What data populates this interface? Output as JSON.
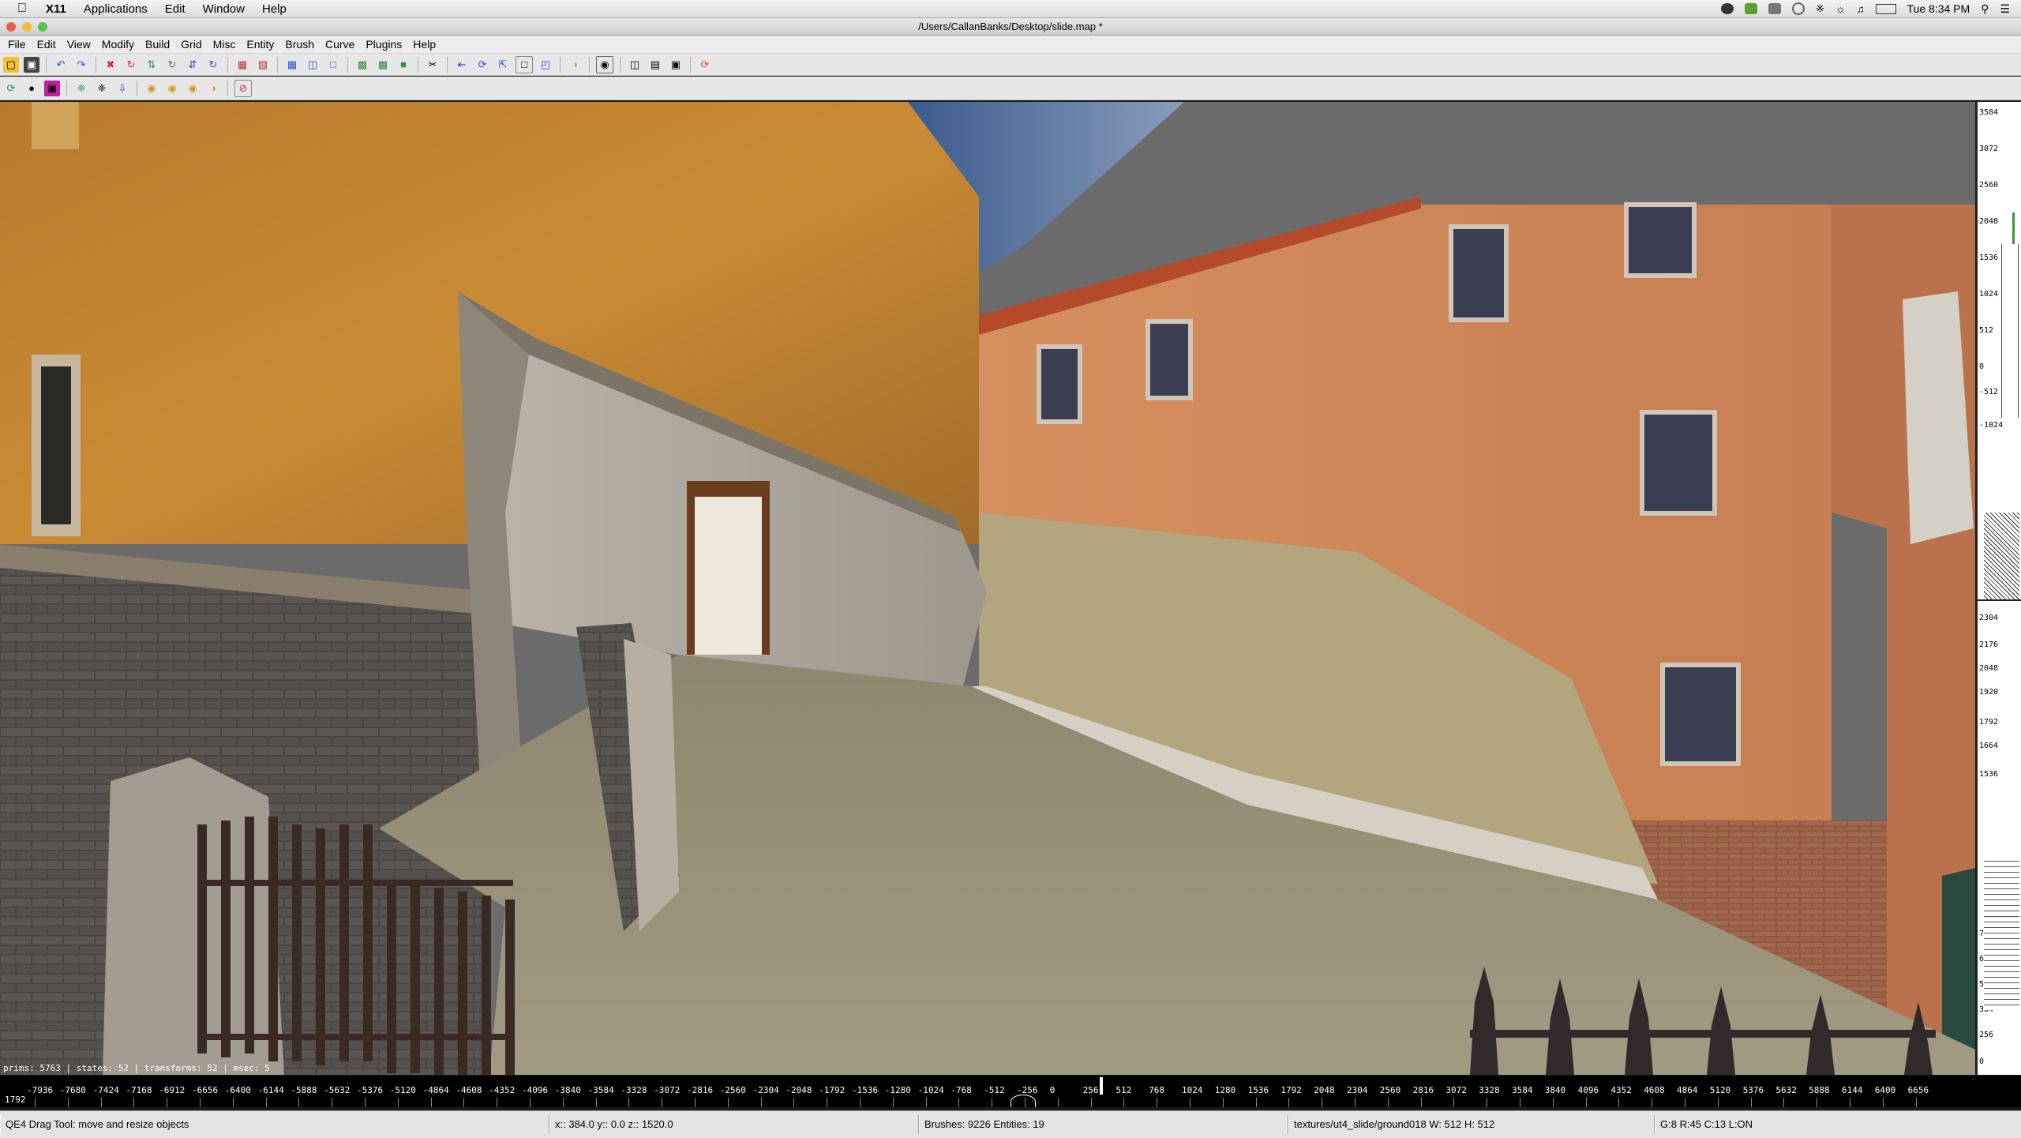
{
  "mac_menu": {
    "app": "X11",
    "items": [
      "Applications",
      "Edit",
      "Window",
      "Help"
    ],
    "clock": "Tue 8:34 PM"
  },
  "window": {
    "title": "/Users/CallanBanks/Desktop/slide.map *"
  },
  "app_menu": [
    "File",
    "Edit",
    "View",
    "Modify",
    "Build",
    "Grid",
    "Misc",
    "Entity",
    "Brush",
    "Curve",
    "Plugins",
    "Help"
  ],
  "viewport": {
    "stats": "prims: 5763 | states: 52 | transforms: 52 | msec: 5"
  },
  "side_ruler": [
    "3584",
    "3072",
    "2560",
    "2048",
    "1536",
    "1024",
    "512",
    "0",
    "-512",
    "-1024",
    "2304",
    "2176",
    "2048",
    "1920",
    "1792",
    "1664",
    "1536",
    "768",
    "640",
    "512",
    "384",
    "256",
    "0"
  ],
  "bottom_ruler": {
    "left_label": "1792",
    "ticks": [
      "-7936",
      "-7680",
      "-7424",
      "-7168",
      "-6912",
      "-6656",
      "-6400",
      "-6144",
      "-5888",
      "-5632",
      "-5376",
      "-5120",
      "-4864",
      "-4608",
      "-4352",
      "-4096",
      "-3840",
      "-3584",
      "-3328",
      "-3072",
      "-2816",
      "-2560",
      "-2304",
      "-2048",
      "-1792",
      "-1536",
      "-1280",
      "-1024",
      "-768",
      "-512",
      "-256",
      "0",
      "256",
      "512",
      "768",
      "1024",
      "1280",
      "1536",
      "1792",
      "2048",
      "2304",
      "2560",
      "2816",
      "3072",
      "3328",
      "3584",
      "3840",
      "4096",
      "4352",
      "4608",
      "4864",
      "5120",
      "5376",
      "5632",
      "5888",
      "6144",
      "6400",
      "6656"
    ]
  },
  "status": {
    "tool": "QE4 Drag Tool: move and resize objects",
    "coords": "x::  384.0  y::    0.0  z:: 1520.0",
    "counts": "Brushes: 9226 Entities: 19",
    "texture": "textures/ut4_slide/ground018 W: 512 H: 512",
    "grid": "G:8  R:45  C:13  L:ON"
  }
}
